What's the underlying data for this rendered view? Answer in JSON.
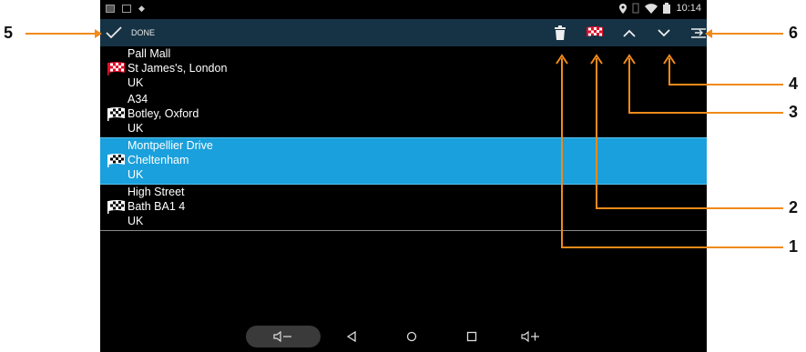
{
  "status_bar": {
    "time": "10:14",
    "icons": [
      "image-icon",
      "notification-icon",
      "lock-icon",
      "location-icon",
      "vibrate-icon",
      "wifi-icon",
      "battery-icon"
    ]
  },
  "action_bar": {
    "done_label": "DONE",
    "done_icon": "checkmark-icon",
    "actions": [
      "trash-icon",
      "checkered-flag-icon",
      "chevron-up-icon",
      "chevron-down-icon",
      "move-to-bottom-icon"
    ]
  },
  "waypoints": [
    {
      "line1": "Pall Mall",
      "line2": "St James's, London",
      "line3": "UK",
      "flag": "red-checkered-flag-icon",
      "selected": false
    },
    {
      "line1": "A34",
      "line2": "Botley, Oxford",
      "line3": "UK",
      "flag": "white-checkered-flag-icon",
      "selected": false
    },
    {
      "line1": "Montpellier Drive",
      "line2": "Cheltenham",
      "line3": "UK",
      "flag": "white-checkered-flag-icon",
      "selected": true
    },
    {
      "line1": "High Street",
      "line2": "Bath BA1 4",
      "line3": "UK",
      "flag": "white-checkered-flag-icon",
      "selected": false
    }
  ],
  "nav_bar": [
    "volume-down-icon",
    "back-icon",
    "home-icon",
    "recents-icon",
    "volume-up-icon"
  ],
  "callouts": [
    "1",
    "2",
    "3",
    "4",
    "5",
    "6"
  ],
  "colors": {
    "action_bar": "#163345",
    "selection": "#1aa0dc",
    "callout": "#f08a1a",
    "flag_red": "#e0102a"
  }
}
